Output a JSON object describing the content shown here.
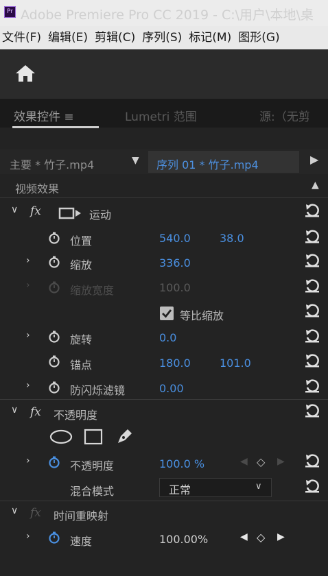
{
  "window": {
    "title": "Adobe Premiere Pro CC 2019 - C:\\用户\\本地\\桌",
    "logo": "Pr"
  },
  "menu": [
    "文件(F)",
    "编辑(E)",
    "剪辑(C)",
    "序列(S)",
    "标记(M)",
    "图形(G)"
  ],
  "tabs": {
    "effects": "效果控件 ≡",
    "lumetri": "Lumetri 范围",
    "source": "源:（无剪"
  },
  "header": {
    "master_clip": "主要 * 竹子.mp4",
    "sequence_clip": "序列 01 * 竹子.mp4"
  },
  "section_title": "视频效果",
  "motion": {
    "name": "运动",
    "position": {
      "label": "位置",
      "x": "540.0",
      "y": "38.0"
    },
    "scale": {
      "label": "缩放",
      "value": "336.0"
    },
    "scale_width": {
      "label": "缩放宽度",
      "value": "100.0"
    },
    "uniform_scale": {
      "label": "等比缩放",
      "checked": true
    },
    "rotation": {
      "label": "旋转",
      "value": "0.0"
    },
    "anchor": {
      "label": "锚点",
      "x": "180.0",
      "y": "101.0"
    },
    "anti_flicker": {
      "label": "防闪烁滤镜",
      "value": "0.00"
    }
  },
  "opacity": {
    "name": "不透明度",
    "opacity": {
      "label": "不透明度",
      "value": "100.0 %"
    },
    "blend_mode": {
      "label": "混合模式",
      "value": "正常"
    }
  },
  "time_remap": {
    "name": "时间重映射",
    "speed": {
      "label": "速度",
      "value": "100.00%"
    }
  },
  "colors": {
    "accent_blue": "#4a90e2",
    "panel_bg": "#232323",
    "title_bg": "#ececec"
  }
}
